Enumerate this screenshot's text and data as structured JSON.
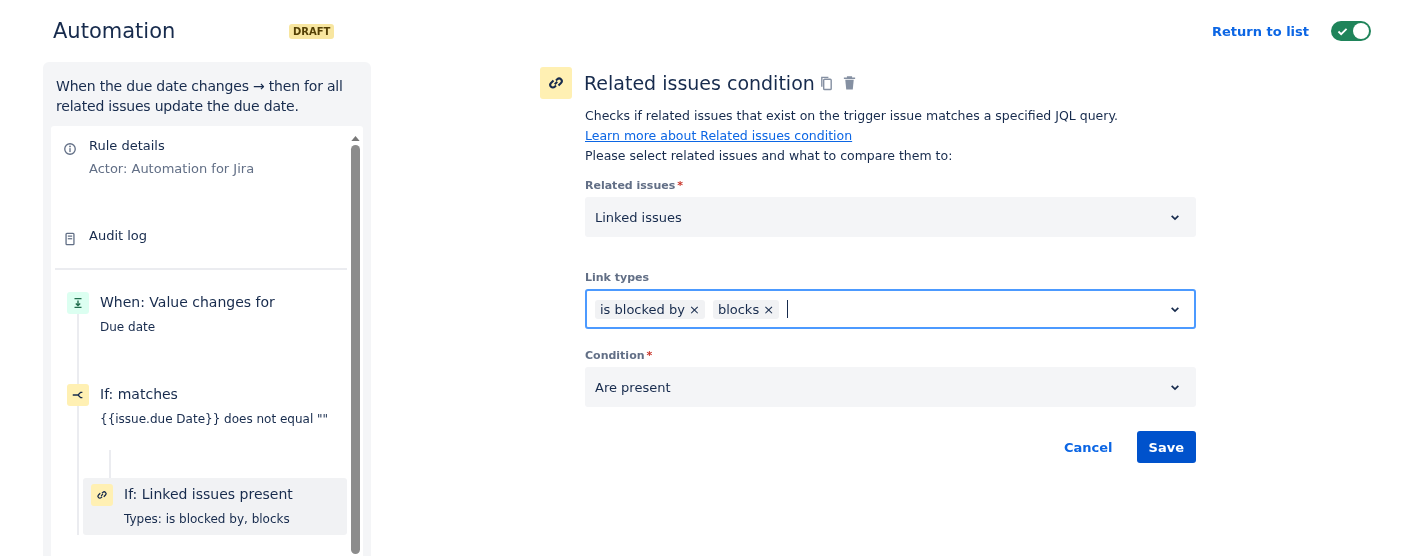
{
  "header": {
    "title": "Automation",
    "status": "DRAFT",
    "return_link": "Return to list",
    "enabled": true
  },
  "rule": {
    "summary": "When the due date changes → then for all related issues update the due date.",
    "meta_items": [
      {
        "kind": "details",
        "label": "Rule details",
        "detail": "Actor: Automation for Jira"
      },
      {
        "kind": "audit",
        "label": "Audit log"
      }
    ],
    "steps": [
      {
        "kind": "trigger",
        "title": "When: Value changes for",
        "detail": "Due date",
        "selected": false
      },
      {
        "kind": "condition",
        "title": "If: matches",
        "detail": "{{issue.due Date}} does not equal \"\"",
        "selected": false,
        "children": [
          {
            "kind": "link",
            "title": "If: Linked issues present",
            "detail": "Types: is blocked by, blocks",
            "selected": true
          }
        ]
      }
    ]
  },
  "editor": {
    "title": "Related issues condition",
    "description": "Checks if related issues that exist on the trigger issue matches a specified JQL query.",
    "learn_more_link": "Learn more about Related issues condition",
    "prompt": "Please select related issues and what to compare them to:",
    "fields": [
      {
        "kind": "select",
        "label": "Related issues",
        "required_mark": "*",
        "value": "Linked issues",
        "focused": false
      },
      {
        "kind": "multi",
        "label": "Link types",
        "tags": [
          {
            "label": "is blocked by",
            "remove": "×"
          },
          {
            "label": "blocks",
            "remove": "×"
          }
        ],
        "focused": true
      },
      {
        "kind": "select",
        "label": "Condition",
        "required_mark": "*",
        "value": "Are present",
        "focused": false
      }
    ],
    "buttons": [
      {
        "kind": "subtle",
        "label": "Cancel"
      },
      {
        "kind": "primary",
        "label": "Save"
      }
    ]
  }
}
